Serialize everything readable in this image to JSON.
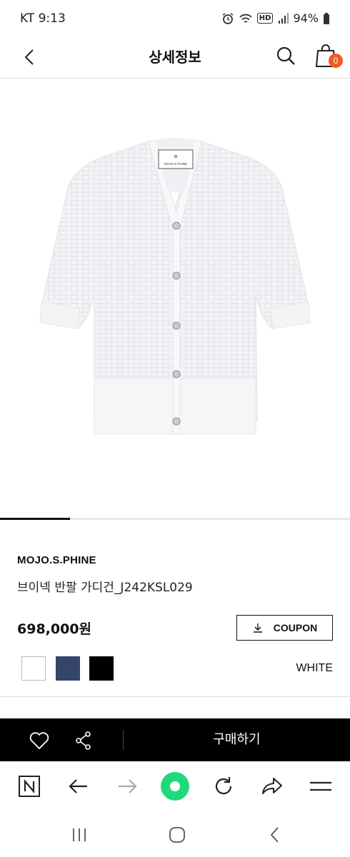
{
  "status": {
    "carrier_time": "KT 9:13",
    "battery": "94%",
    "network_badge": "HD"
  },
  "header": {
    "title": "상세정보",
    "cart_count": "0"
  },
  "product_image": {
    "label_text": "MOJO.S.PHINE"
  },
  "product": {
    "brand": "MOJO.S.PHINE",
    "name": "브이넥 반팔 가디건_J242KSL029",
    "price": "698,000원",
    "coupon_label": "COUPON",
    "colors": [
      "white",
      "navy",
      "black"
    ],
    "selected_color": "WHITE",
    "image_index": 1
  },
  "buybar": {
    "buy_label": "구매하기"
  },
  "colors": {
    "accent_badge": "#f15a22",
    "swatch_navy": "#33456a",
    "swatch_black": "#000000",
    "browser_home": "#1fd97c"
  }
}
